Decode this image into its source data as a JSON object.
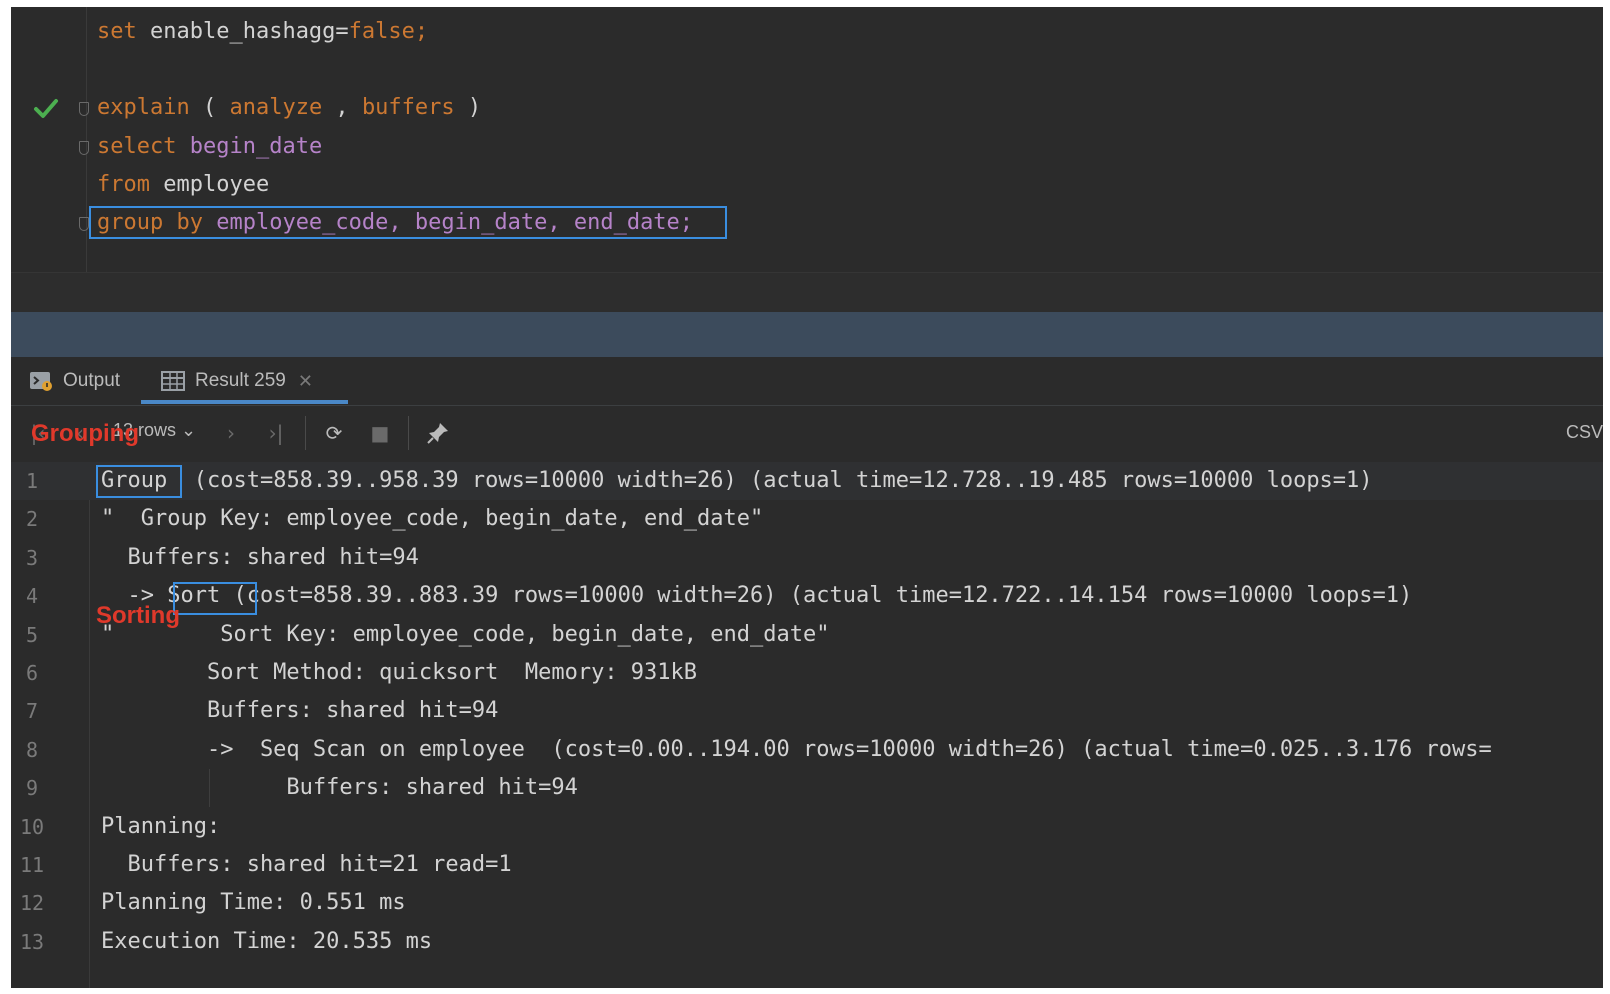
{
  "editor": {
    "line1": {
      "kw": "set",
      "rest": " enable_hashagg=",
      "val": "false;"
    },
    "line2": {
      "kw": "explain",
      "p1": " ( ",
      "a": "analyze",
      "p2": " , ",
      "b": "buffers",
      "p3": " )"
    },
    "line3": {
      "kw": "select",
      "sp": " ",
      "col": "begin_date"
    },
    "line4": {
      "kw": "from",
      "rest": " employee"
    },
    "line5": {
      "kw": "group by",
      "sp": " ",
      "cols": "employee_code, begin_date, end_date;"
    }
  },
  "tabs": {
    "output": "Output",
    "result": "Result 259",
    "close": "✕"
  },
  "toolbar": {
    "rows": "13 rows",
    "csv": "CSV"
  },
  "annotations": {
    "grouping": "Grouping",
    "sorting": "Sorting"
  },
  "results": {
    "rows": [
      {
        "n": "1",
        "pre": "",
        "boxed": "Group",
        "post": "  (cost=858.39..958.39 rows=10000 width=26) (actual time=12.728..19.485 rows=10000 loops=1)"
      },
      {
        "n": "2",
        "text": "\"  Group Key: employee_code, begin_date, end_date\""
      },
      {
        "n": "3",
        "text": "  Buffers: shared hit=94"
      },
      {
        "n": "4",
        "pre": "  -> ",
        "boxed": "Sort",
        "post": " (cost=858.39..883.39 rows=10000 width=26) (actual time=12.722..14.154 rows=10000 loops=1)"
      },
      {
        "n": "5",
        "text": "\"        Sort Key: employee_code, begin_date, end_date\""
      },
      {
        "n": "6",
        "text": "        Sort Method: quicksort  Memory: 931kB"
      },
      {
        "n": "7",
        "text": "        Buffers: shared hit=94"
      },
      {
        "n": "8",
        "text": "        ->  Seq Scan on employee  (cost=0.00..194.00 rows=10000 width=26) (actual time=0.025..3.176 rows="
      },
      {
        "n": "9",
        "text": "              Buffers: shared hit=94"
      },
      {
        "n": "10",
        "text": "Planning:"
      },
      {
        "n": "11",
        "text": "  Buffers: shared hit=21 read=1"
      },
      {
        "n": "12",
        "text": "Planning Time: 0.551 ms"
      },
      {
        "n": "13",
        "text": "Execution Time: 20.535 ms"
      }
    ]
  },
  "colors": {
    "keyword": "#cc7832",
    "column": "#b683c9",
    "highlight_box": "#3a8ee0",
    "annotation": "#e0392b",
    "check": "#4caf50"
  }
}
